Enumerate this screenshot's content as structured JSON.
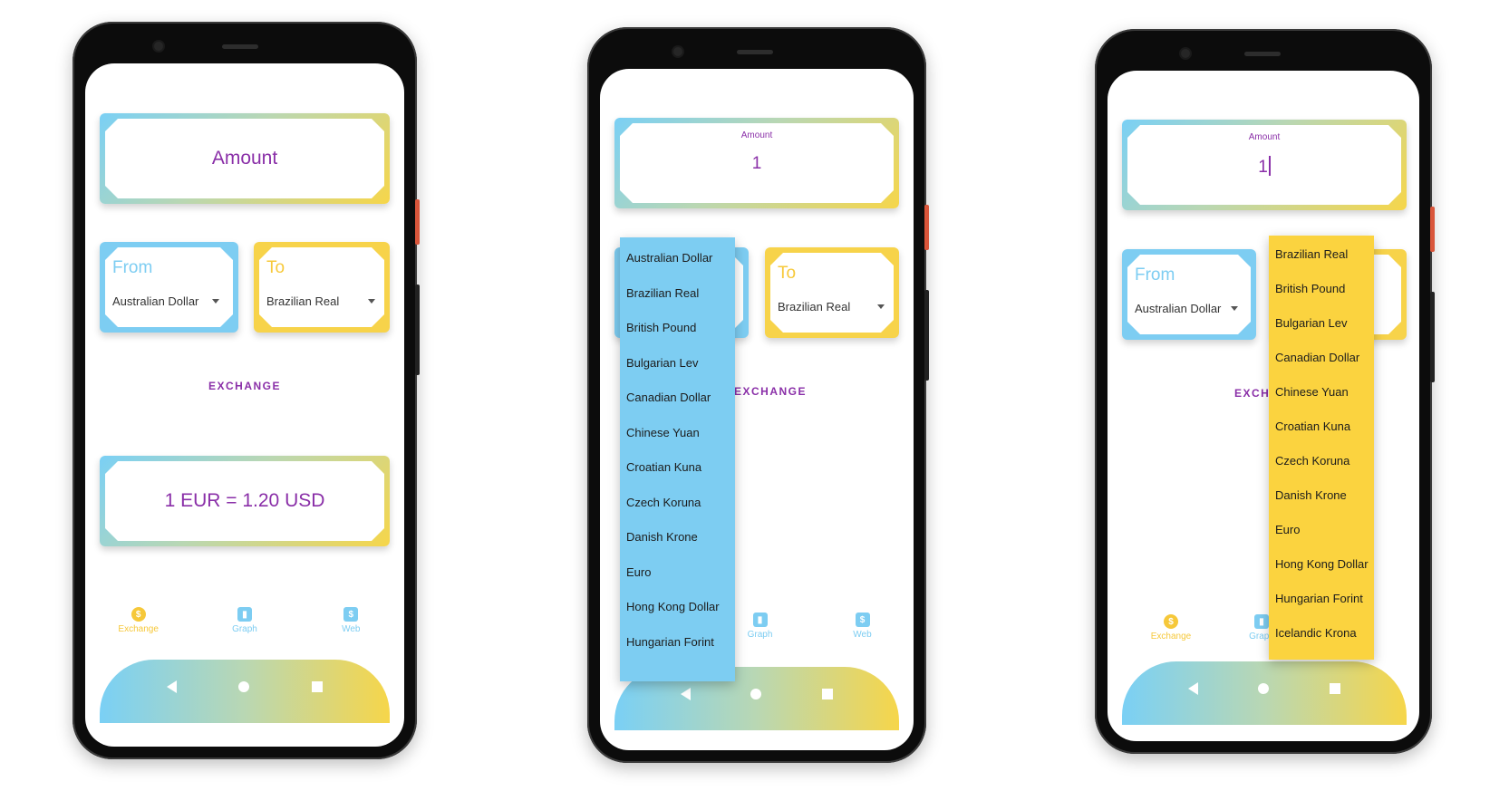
{
  "phones": [
    {
      "amount": {
        "label": "Amount"
      },
      "from": {
        "label": "From",
        "value": "Australian Dollar"
      },
      "to": {
        "label": "To",
        "value": "Brazilian Real"
      },
      "exchange_button": "EXCHANGE",
      "result": "1 EUR = 1.20 USD",
      "nav": [
        "Exchange",
        "Graph",
        "Web"
      ]
    },
    {
      "amount": {
        "label": "Amount",
        "value": "1"
      },
      "to": {
        "label": "To",
        "value": "Brazilian Real"
      },
      "exchange_button": "EXCHANGE",
      "nav": [
        "Graph",
        "Web"
      ],
      "dropdown": [
        "Australian Dollar",
        "Brazilian Real",
        "British Pound",
        "Bulgarian Lev",
        "Canadian Dollar",
        "Chinese Yuan",
        "Croatian Kuna",
        "Czech Koruna",
        "Danish Krone",
        "Euro",
        "Hong Kong Dollar",
        "Hungarian Forint"
      ]
    },
    {
      "amount": {
        "label": "Amount",
        "value": "1"
      },
      "from": {
        "label": "From",
        "value": "Australian Dollar"
      },
      "exchange_button": "EXCHAN",
      "nav": [
        "Exchange",
        "Graph"
      ],
      "dropdown": [
        "Brazilian Real",
        "British Pound",
        "Bulgarian Lev",
        "Canadian Dollar",
        "Chinese Yuan",
        "Croatian Kuna",
        "Czech Koruna",
        "Danish Krone",
        "Euro",
        "Hong Kong Dollar",
        "Hungarian Forint",
        "Icelandic Krona"
      ]
    }
  ],
  "colors": {
    "blue": "#7dcdf2",
    "yellow": "#f7d34a",
    "purple": "#8a2fa8"
  },
  "icons": {
    "exchange": "dollar-coin-icon",
    "graph": "bar-chart-icon",
    "web": "dollar-doc-icon"
  }
}
